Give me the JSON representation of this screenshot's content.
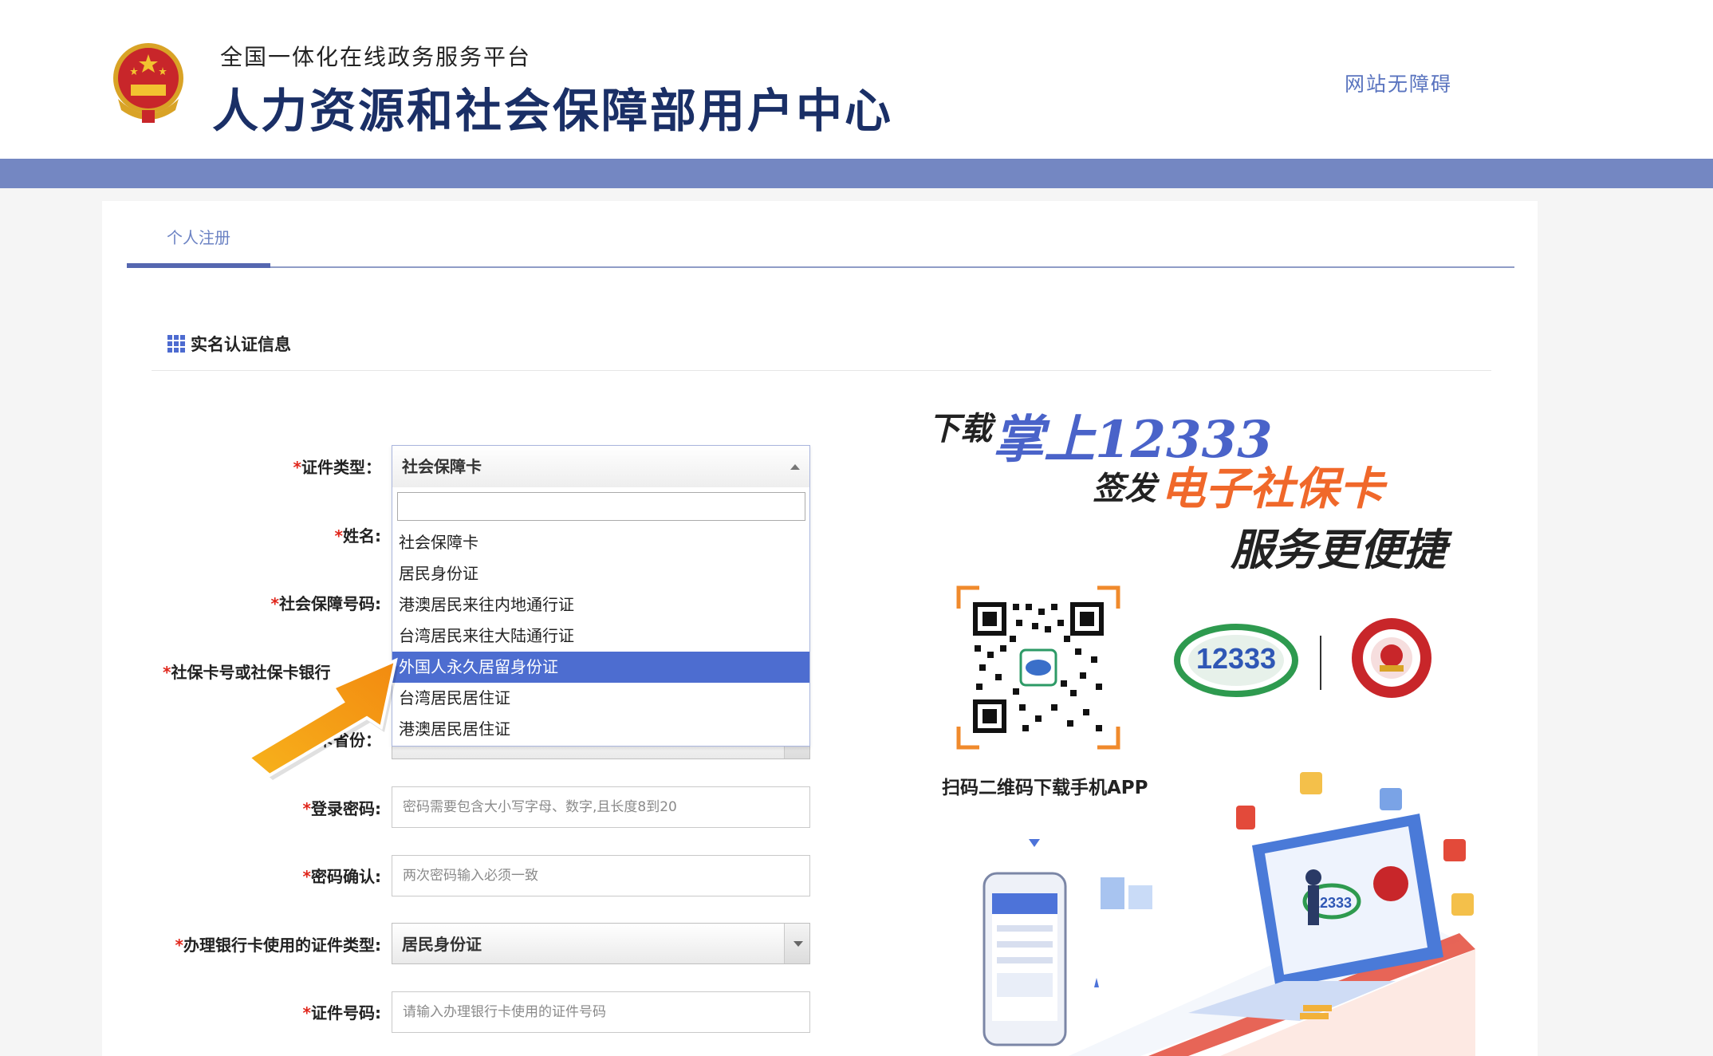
{
  "header": {
    "subtitle": "全国一体化在线政务服务平台",
    "title": "人力资源和社会保障部用户中心",
    "accessibility_link": "网站无障碍"
  },
  "tabs": [
    {
      "label": "个人注册",
      "active": true
    }
  ],
  "section": {
    "title": "实名认证信息"
  },
  "form": {
    "cert_type": {
      "label": "证件类型：",
      "value": "社会保障卡"
    },
    "name": {
      "label": "姓名:"
    },
    "social_security_no": {
      "label": "社会保障号码:"
    },
    "card_no": {
      "label": "社保卡号或社保卡银行"
    },
    "card_province": {
      "label": "卡省份："
    },
    "password": {
      "label": "登录密码:",
      "placeholder": "密码需要包含大小写字母、数字,且长度8到20"
    },
    "password_confirm": {
      "label": "密码确认:",
      "placeholder": "两次密码输入必须一致"
    },
    "bank_cert_type": {
      "label": "办理银行卡使用的证件类型:",
      "value": "居民身份证"
    },
    "cert_no": {
      "label": "证件号码:",
      "placeholder": "请输入办理银行卡使用的证件号码"
    },
    "required_mark": "*"
  },
  "dropdown": {
    "open": true,
    "selected": "社会保障卡",
    "highlighted_index": 4,
    "options": [
      "社会保障卡",
      "居民身份证",
      "港澳居民来往内地通行证",
      "台湾居民来往大陆通行证",
      "外国人永久居留身份证",
      "台湾居民居住证",
      "港澳居民居住证"
    ]
  },
  "promo": {
    "line1_prefix": "下载",
    "line1_app": "掌上12333",
    "line2_prefix": "签发",
    "line2_card": "电子社保卡",
    "line3": "服务更便捷",
    "qr_caption": "扫码二维码下载手机APP"
  },
  "colors": {
    "band": "#7487c2",
    "accent": "#4d6dd0",
    "title": "#1a2f66",
    "orange": "#f0682a",
    "required": "#e0261b"
  }
}
